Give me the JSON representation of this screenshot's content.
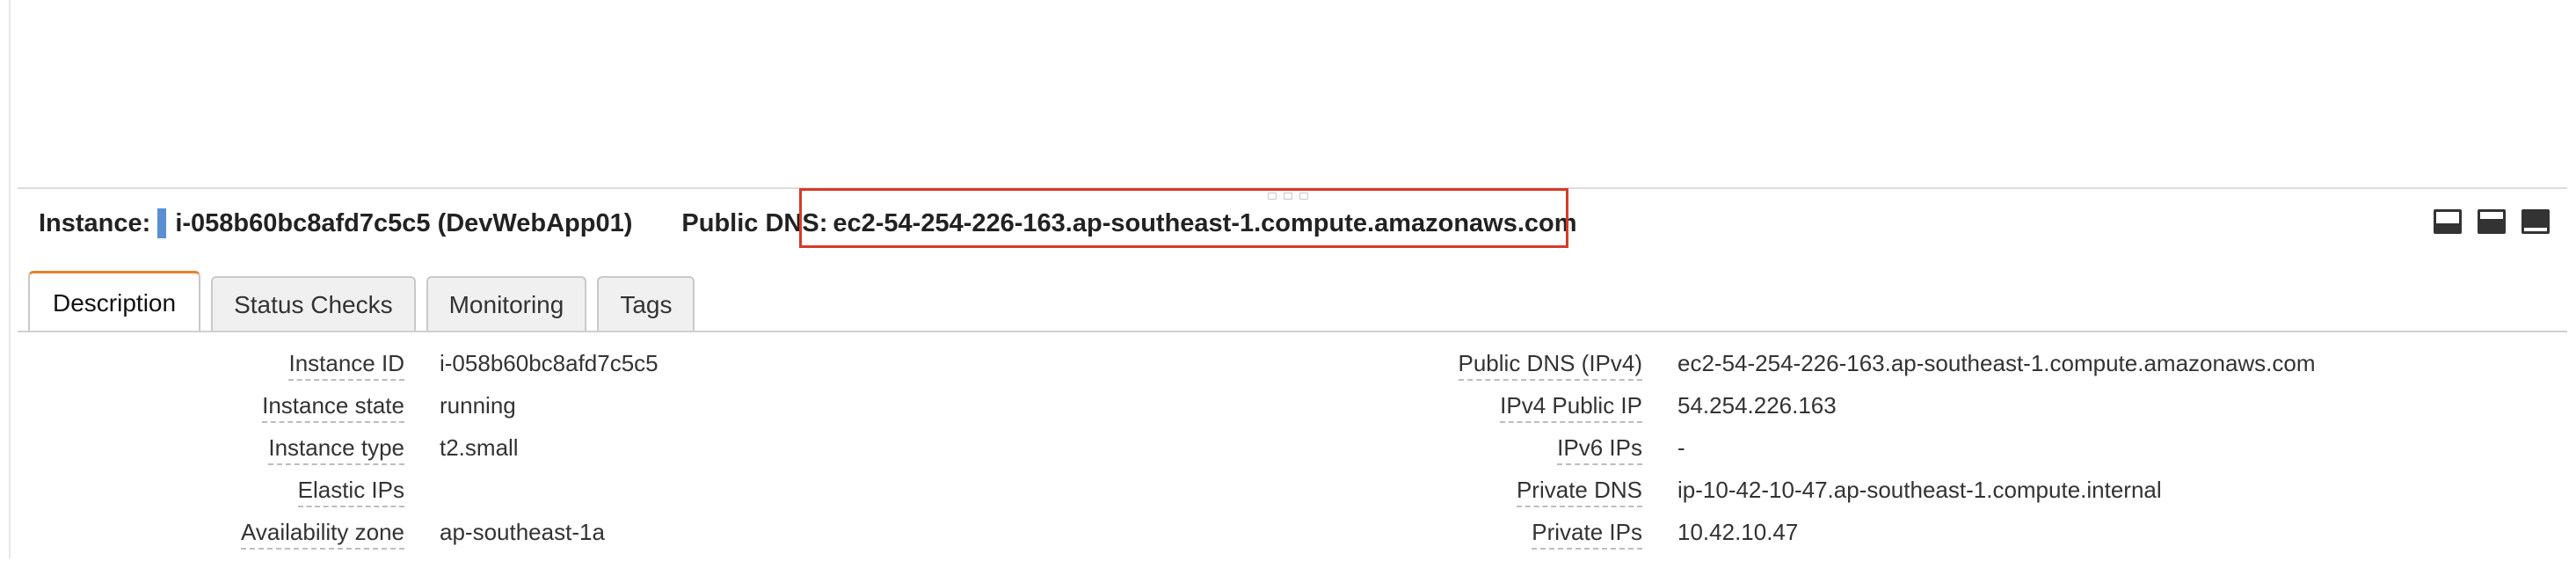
{
  "instance_bar": {
    "instance_label": "Instance:",
    "instance_name": "i-058b60bc8afd7c5c5 (DevWebApp01)",
    "dns_label": "Public DNS:",
    "dns_value": "ec2-54-254-226-163.ap-southeast-1.compute.amazonaws.com",
    "color_chip": "#5b8fd4",
    "highlight_color": "#d53b2b"
  },
  "tabs": [
    {
      "label": "Description",
      "active": true
    },
    {
      "label": "Status Checks",
      "active": false
    },
    {
      "label": "Monitoring",
      "active": false
    },
    {
      "label": "Tags",
      "active": false
    }
  ],
  "left_details": [
    {
      "label": "Instance ID",
      "value": "i-058b60bc8afd7c5c5"
    },
    {
      "label": "Instance state",
      "value": "running"
    },
    {
      "label": "Instance type",
      "value": "t2.small"
    },
    {
      "label": "Elastic IPs",
      "value": ""
    },
    {
      "label": "Availability zone",
      "value": "ap-southeast-1a"
    }
  ],
  "right_details": [
    {
      "label": "Public DNS (IPv4)",
      "value": "ec2-54-254-226-163.ap-southeast-1.compute.amazonaws.com"
    },
    {
      "label": "IPv4 Public IP",
      "value": "54.254.226.163"
    },
    {
      "label": "IPv6 IPs",
      "value": "-"
    },
    {
      "label": "Private DNS",
      "value": "ip-10-42-10-47.ap-southeast-1.compute.internal"
    },
    {
      "label": "Private IPs",
      "value": "10.42.10.47"
    }
  ],
  "panel_icons": [
    "panel-bottom-icon",
    "panel-half-icon",
    "panel-full-icon"
  ],
  "accent_color": "#e8822a"
}
